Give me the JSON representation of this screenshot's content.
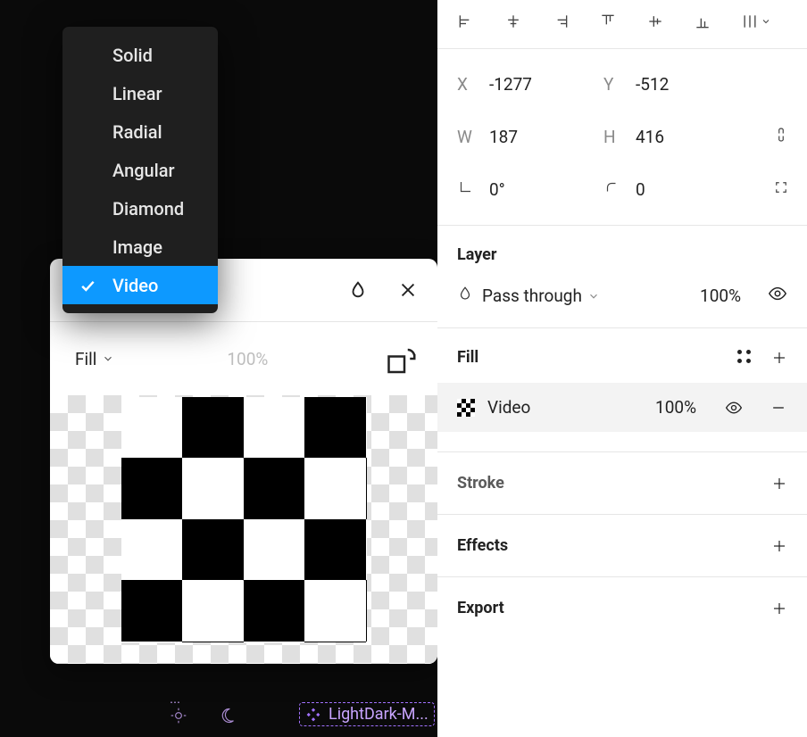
{
  "fillTypeMenu": {
    "items": [
      "Solid",
      "Linear",
      "Radial",
      "Angular",
      "Diamond",
      "Image",
      "Video"
    ],
    "selected": "Video"
  },
  "fillPanel": {
    "modeLabel": "Fill",
    "opacity": "100%"
  },
  "canvasWidget": {
    "label": "LightDark-M..."
  },
  "props": {
    "position": {
      "xLabel": "X",
      "xValue": "-1277",
      "yLabel": "Y",
      "yValue": "-512"
    },
    "size": {
      "wLabel": "W",
      "wValue": "187",
      "hLabel": "H",
      "hValue": "416"
    },
    "rotation": {
      "angleValue": "0°",
      "cornerValue": "0"
    },
    "layerSection": {
      "title": "Layer",
      "blendMode": "Pass through",
      "opacity": "100%"
    },
    "fillSection": {
      "title": "Fill",
      "entry": {
        "name": "Video",
        "opacity": "100%"
      }
    },
    "stroke": {
      "title": "Stroke"
    },
    "effects": {
      "title": "Effects"
    },
    "export": {
      "title": "Export"
    }
  }
}
